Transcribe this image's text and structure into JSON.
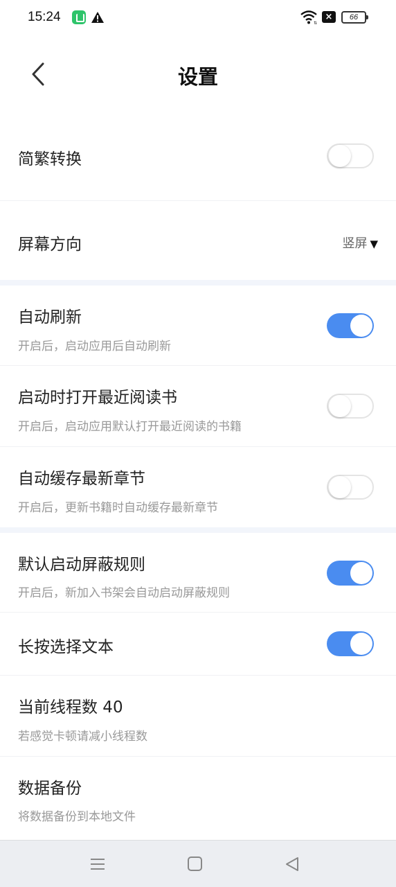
{
  "status_bar": {
    "time": "15:24",
    "battery": "66",
    "icons": [
      "app-icon",
      "warning-icon",
      "wifi-icon",
      "signal-off-icon",
      "battery-icon"
    ]
  },
  "header": {
    "title": "设置",
    "back_icon": "chevron-left-icon"
  },
  "settings": {
    "simplified_traditional": {
      "title": "简繁转换",
      "enabled": false
    },
    "screen_orientation": {
      "title": "屏幕方向",
      "value": "竖屏",
      "caret": "▼"
    },
    "auto_refresh": {
      "title": "自动刷新",
      "subtitle": "开启后，启动应用后自动刷新",
      "enabled": true
    },
    "open_recent_book": {
      "title": "启动时打开最近阅读书",
      "subtitle": "开启后，启动应用默认打开最近阅读的书籍",
      "enabled": false
    },
    "auto_cache_chapter": {
      "title": "自动缓存最新章节",
      "subtitle": "开启后，更新书籍时自动缓存最新章节",
      "enabled": false
    },
    "default_block_rules": {
      "title": "默认启动屏蔽规则",
      "subtitle": "开启后，新加入书架会自动启动屏蔽规则",
      "enabled": true
    },
    "long_press_select": {
      "title": "长按选择文本",
      "enabled": true
    },
    "thread_count": {
      "title": "当前线程数 40",
      "subtitle": "若感觉卡顿请减小线程数"
    },
    "data_backup": {
      "title": "数据备份",
      "subtitle": "将数据备份到本地文件"
    }
  },
  "nav_bar": {
    "icons": [
      "menu-icon",
      "home-icon",
      "back-triangle-icon"
    ]
  },
  "colors": {
    "toggle_on": "#4a8cf0",
    "section_gap": "#f2f5fb",
    "nav_bg": "#eceef2"
  }
}
